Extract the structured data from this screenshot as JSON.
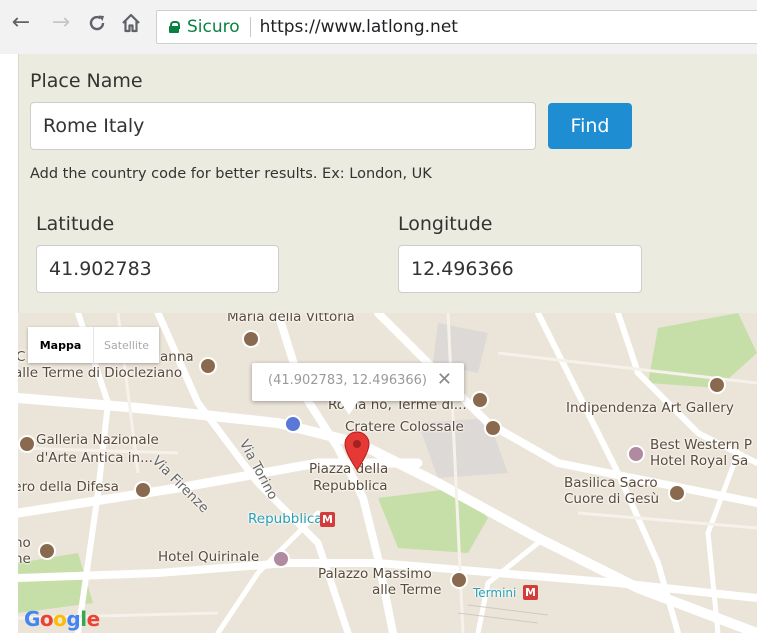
{
  "browser": {
    "back_icon": "arrow-left-icon",
    "forward_icon": "arrow-right-icon",
    "reload_icon": "reload-icon",
    "home_icon": "home-icon",
    "security_label": "Sicuro",
    "url": "https://www.latlong.net"
  },
  "form": {
    "place_label": "Place Name",
    "place_value": "Rome Italy",
    "find_label": "Find",
    "hint": "Add the country code for better results. Ex: London, UK",
    "lat_label": "Latitude",
    "lat_value": "41.902783",
    "lng_label": "Longitude",
    "lng_value": "12.496366"
  },
  "map": {
    "type_active": "Mappa",
    "type_inactive": "Satellite",
    "infowindow": "(41.902783, 12.496366)",
    "infowindow_close": "✕",
    "labels": {
      "maria_della_vittoria": "Maria della Vittoria",
      "terme_diocleziano_1": "anna",
      "terme_diocleziano_2": "alle Terme di Diocleziano",
      "galleria_1": "Galleria Nazionale",
      "galleria_2": "d'Arte Antica in...",
      "difesa": "tero della Difesa",
      "roma_terme": "Roma no, Terme di...",
      "cratere": "Cratere Colossale",
      "indipendenza": "Indipendenza Art Gallery",
      "best_western_1": "Best Western P",
      "best_western_2": "Hotel Royal Sa",
      "piazza_1": "Piazza della",
      "piazza_2": "Repubblica",
      "basilica_1": "Basilica Sacro",
      "basilica_2": "Cuore di Gesù",
      "repubblica_metro": "Repubblica",
      "hotel_quirinale": "Hotel Quirinale",
      "palazzo_1": "Palazzo Massimo",
      "palazzo_2": "alle Terme",
      "termini": "Termini",
      "via_firenze": "Via Firenze",
      "via_torino": "Via Torino",
      "left_edge_1": "no",
      "left_edge_2": "ne",
      "left_c": "C"
    },
    "metro_letter": "M",
    "logo": "Google"
  },
  "colors": {
    "accent": "#1e8dd2",
    "secure_green": "#0b8043",
    "panel_bg": "#ecebe0",
    "map_bg": "#ebe4d8",
    "marker_red": "#e53935"
  }
}
